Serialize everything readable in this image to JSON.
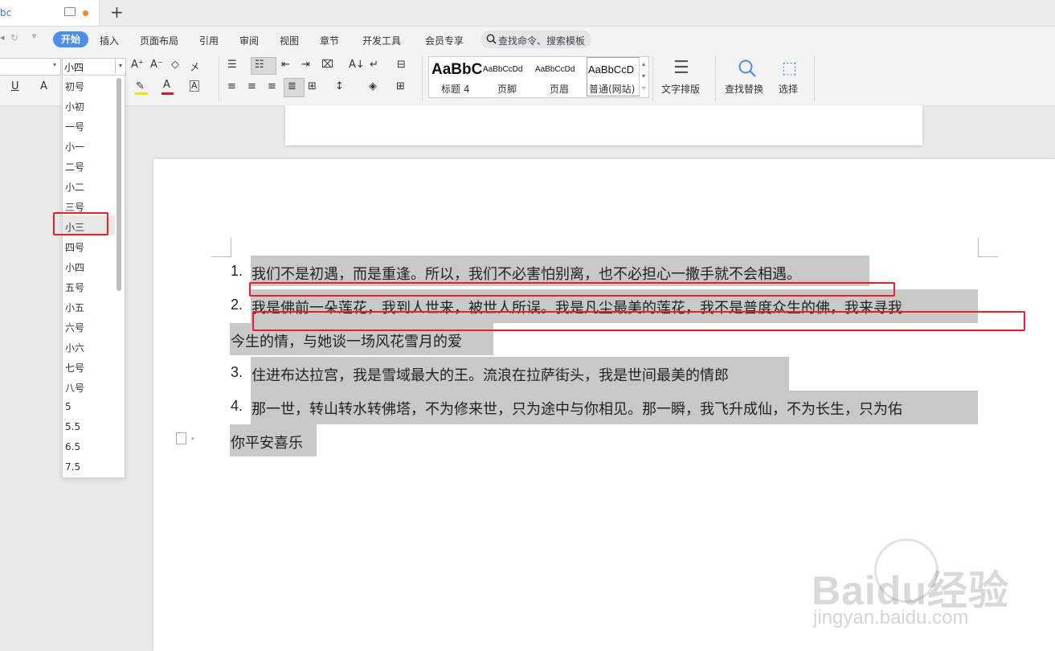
{
  "tabbar": {
    "doc_tab_title": "bc",
    "new_tab": "+"
  },
  "menu": {
    "items": [
      "开始",
      "插入",
      "页面布局",
      "引用",
      "审阅",
      "视图",
      "章节",
      "开发工具",
      "会员专享"
    ],
    "search": "查找命令、搜索模板"
  },
  "ribbon": {
    "font_size_value": "小四",
    "styles": [
      {
        "sample": "AaBbC",
        "name": "标题 4"
      },
      {
        "sample": "AaBbCcDd",
        "name": "页脚"
      },
      {
        "sample": "AaBbCcDd",
        "name": "页眉"
      },
      {
        "sample": "AaBbCcD",
        "name": "普通(网站)"
      }
    ],
    "text_layout": "文字排版",
    "find_replace": "查找替换",
    "select": "选择"
  },
  "dropdown": {
    "items": [
      "初号",
      "小初",
      "一号",
      "小一",
      "二号",
      "小二",
      "三号",
      "小三",
      "四号",
      "小四",
      "五号",
      "小五",
      "六号",
      "小六",
      "七号",
      "八号",
      "5",
      "5.5",
      "6.5",
      "7.5"
    ],
    "selected": "小三"
  },
  "document": {
    "items": [
      {
        "num": "1.",
        "lines": [
          "我们不是初遇，而是重逢。所以，我们不必害怕别离，也不必担心一撒手就不会相遇。"
        ]
      },
      {
        "num": "2.",
        "lines": [
          "我是佛前一朵莲花，我到人世来，被世人所误。我是凡尘最美的莲花，我不是普度众生的佛，我来寻我",
          "今生的情，与她谈一场风花雪月的爱"
        ]
      },
      {
        "num": "3.",
        "lines": [
          "住进布达拉宫，我是雪域最大的王。流浪在拉萨街头，我是世间最美的情郎"
        ]
      },
      {
        "num": "4.",
        "lines": [
          "那一世，转山转水转佛塔，不为修来世，只为途中与你相见。那一瞬，我飞升成仙，不为长生，只为佑",
          "你平安喜乐"
        ]
      }
    ]
  },
  "watermark": {
    "logo": "Baidu经验",
    "url": "jingyan.baidu.com"
  },
  "colors": {
    "accent": "#4a8ef0",
    "highlight": "#c8c8c8",
    "annotation_red": "#e8202a"
  }
}
